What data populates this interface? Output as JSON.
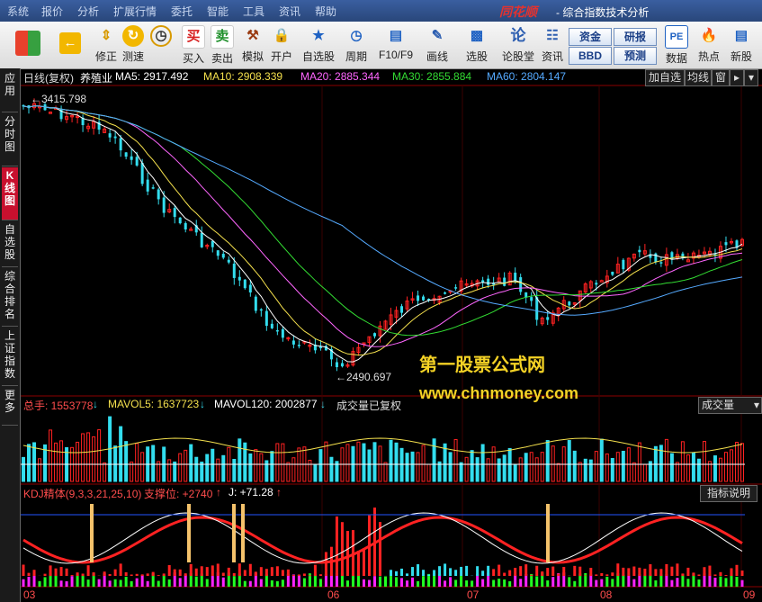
{
  "menu": [
    "系统",
    "报价",
    "分析",
    "扩展行情",
    "委托",
    "智能",
    "工具",
    "资讯",
    "帮助"
  ],
  "brand": "同花顺",
  "window_title": "- 综合指数技术分析",
  "toolbar": [
    {
      "label": "",
      "icon": "windows-icon"
    },
    {
      "label": "",
      "icon": "back-arrow-icon"
    },
    {
      "label": "修正",
      "icon": "up-down-arrows-icon"
    },
    {
      "label": "测速",
      "icon": "speed-icon"
    },
    {
      "label": "",
      "icon": "clock-icon"
    },
    {
      "label": "买入",
      "icon": "buy-icon",
      "glyph": "买"
    },
    {
      "label": "卖出",
      "icon": "sell-icon",
      "glyph": "卖"
    },
    {
      "label": "模拟",
      "icon": "hammer-icon"
    },
    {
      "label": "开户",
      "icon": "lock-icon"
    },
    {
      "label": "自选股",
      "icon": "star-icon"
    },
    {
      "label": "周期",
      "icon": "cycle-icon"
    },
    {
      "label": "F10/F9",
      "icon": "f10-icon"
    },
    {
      "label": "画线",
      "icon": "pencil-icon"
    },
    {
      "label": "选股",
      "icon": "screen-icon"
    },
    {
      "label": "论股堂",
      "icon": "forum-icon",
      "glyph": "论"
    },
    {
      "label": "资讯",
      "icon": "news-icon"
    },
    {
      "label": "数据",
      "icon": "pe-data-icon",
      "glyph": "PE"
    },
    {
      "label": "热点",
      "icon": "hot-icon"
    },
    {
      "label": "新股",
      "icon": "new-stock-icon"
    }
  ],
  "toolbar_small_buttons": [
    "资金",
    "研报",
    "BBD",
    "预测"
  ],
  "left_tabs": [
    "应用",
    "分时图",
    "K线图",
    "自选股",
    "综合排名",
    "上证指数",
    "更多"
  ],
  "chart_header": {
    "period": "日线(复权)",
    "sector": "养殖业",
    "ma": [
      {
        "label": "MA5: 2917.492",
        "color": "#ffffff"
      },
      {
        "label": "MA10: 2908.339",
        "color": "#f4e04d"
      },
      {
        "label": "MA20: 2885.344",
        "color": "#ff66ff"
      },
      {
        "label": "MA30: 2855.884",
        "color": "#33dd33"
      },
      {
        "label": "MA60: 2804.147",
        "color": "#55aaff"
      }
    ],
    "buttons": [
      "加自选",
      "均线",
      "窗"
    ]
  },
  "annotations": {
    "high": "3415.798",
    "low": "2490.697"
  },
  "volume_header": {
    "total": "总手: 1553778",
    "mavol5": "MAVOL5: 1637723",
    "mavol120": "MAVOL120: 2002877",
    "note": "成交量已复权",
    "selector": "成交量"
  },
  "kdj_header": {
    "name": "KDJ精体(9,3,3,21,25,10)",
    "support": "支撑位: +2740",
    "j": "J: +71.28",
    "explain": "指标说明"
  },
  "x_axis": [
    "03",
    "06",
    "07",
    "08",
    "09"
  ],
  "watermark": {
    "line1": "第一股票公式网",
    "line2": "www.chnmoney.com"
  },
  "colors": {
    "up": "#ff2222",
    "down": "#33ddee",
    "ma5": "#ffffff",
    "ma10": "#f4e04d",
    "ma20": "#ff66ff",
    "ma30": "#33dd33",
    "ma60": "#55aaff"
  }
}
